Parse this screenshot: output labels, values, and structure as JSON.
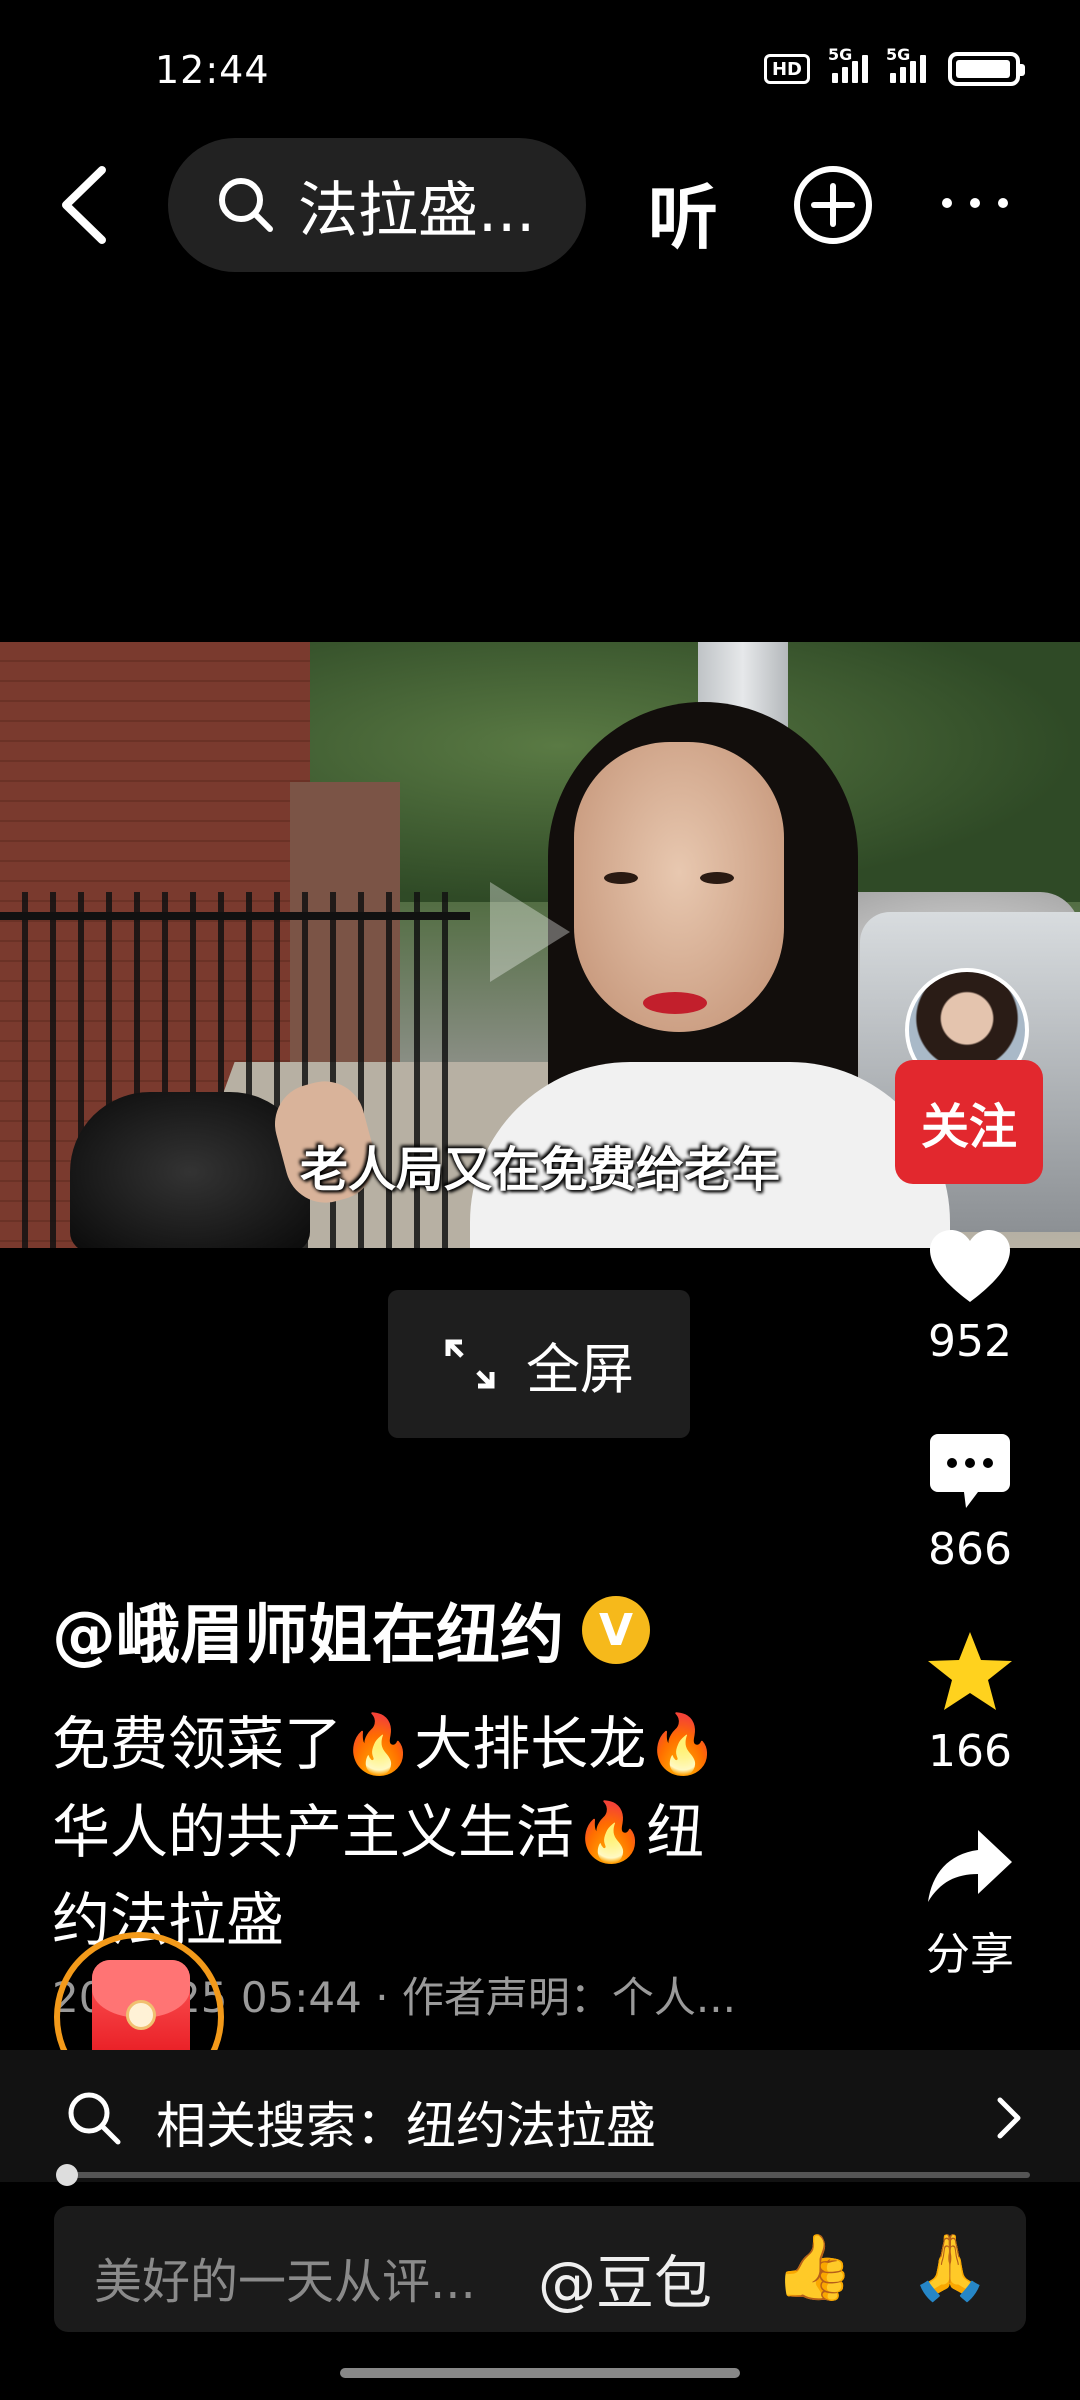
{
  "status_bar": {
    "time": "12:44",
    "hd_label": "HD",
    "sig1_label": "5G",
    "sig2_label": "5G"
  },
  "top_nav": {
    "search_text": "法拉盛...",
    "listen_label": "听"
  },
  "video": {
    "caption": "老人局又在免费给老年"
  },
  "follow_label": "关注",
  "fullscreen_label": "全屏",
  "actions": {
    "likes": "952",
    "comments": "866",
    "favorites": "166",
    "share_label": "分享"
  },
  "post": {
    "author": "@峨眉师姐在纽约",
    "verified_mark": "V",
    "desc_line1": "免费领菜了🔥大排长龙🔥",
    "desc_line2": "华人的共产主义生活🔥纽",
    "desc_line3": "约法拉盛",
    "meta": "2025-25 05:44 · 作者声明：个人..."
  },
  "related_search": {
    "label": "相关搜索：纽约法拉盛"
  },
  "comment_bar": {
    "placeholder": "美好的一天从评...",
    "mention": "@豆包",
    "emoji_thumb": "👍",
    "emoji_pray": "🙏"
  },
  "colors": {
    "accent_red": "#e2282e",
    "ring_orange": "#f39a1a",
    "verified_gold": "#f6b91b",
    "star_yellow": "#ffd21e"
  },
  "icons": [
    "back-icon",
    "search-icon",
    "add-circle-icon",
    "more-icon",
    "expand-icon",
    "heart-icon",
    "comment-icon",
    "star-icon",
    "share-icon",
    "red-envelope-icon",
    "chevron-right-icon"
  ]
}
